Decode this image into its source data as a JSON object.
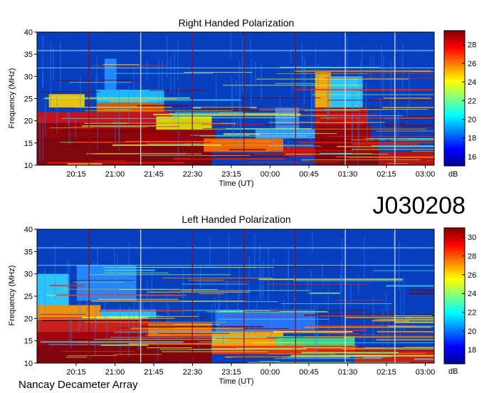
{
  "chart_data": [
    {
      "type": "heatmap",
      "title": "Right Handed Polarization",
      "xlabel": "Time (UT)",
      "ylabel": "Frequency (MHz)",
      "x_ticks": [
        "20:15",
        "21:00",
        "21:45",
        "22:30",
        "23:15",
        "00:00",
        "00:45",
        "01:30",
        "02:15",
        "03:00"
      ],
      "y_ticks": [
        10,
        15,
        20,
        25,
        30,
        35,
        40
      ],
      "ylim": [
        10,
        40
      ],
      "colorbar": {
        "label": "dB",
        "ticks": [
          16,
          18,
          20,
          22,
          24,
          26,
          28
        ],
        "range": [
          15,
          29.5
        ]
      },
      "colormap": [
        "#00008f",
        "#0000ff",
        "#0080ff",
        "#00ffff",
        "#80ff80",
        "#ffff00",
        "#ff8000",
        "#ff0000",
        "#800000"
      ]
    },
    {
      "type": "heatmap",
      "title": "Left Handed Polarization",
      "xlabel": "Time (UT)",
      "ylabel": "Frequency (MHz)",
      "x_ticks": [
        "20:15",
        "21:00",
        "21:45",
        "22:30",
        "23:15",
        "00:00",
        "00:45",
        "01:30",
        "02:15",
        "03:00"
      ],
      "y_ticks": [
        10,
        15,
        20,
        25,
        30,
        35,
        40
      ],
      "ylim": [
        10,
        40
      ],
      "colorbar": {
        "label": "dB",
        "ticks": [
          18,
          20,
          22,
          24,
          26,
          28,
          30
        ],
        "range": [
          16.5,
          31
        ]
      },
      "colormap": [
        "#00008f",
        "#0000ff",
        "#0080ff",
        "#00ffff",
        "#80ff80",
        "#ffff00",
        "#ff8000",
        "#ff0000",
        "#800000"
      ]
    }
  ],
  "label": "J030208",
  "footer": "Nancay Decameter Array"
}
